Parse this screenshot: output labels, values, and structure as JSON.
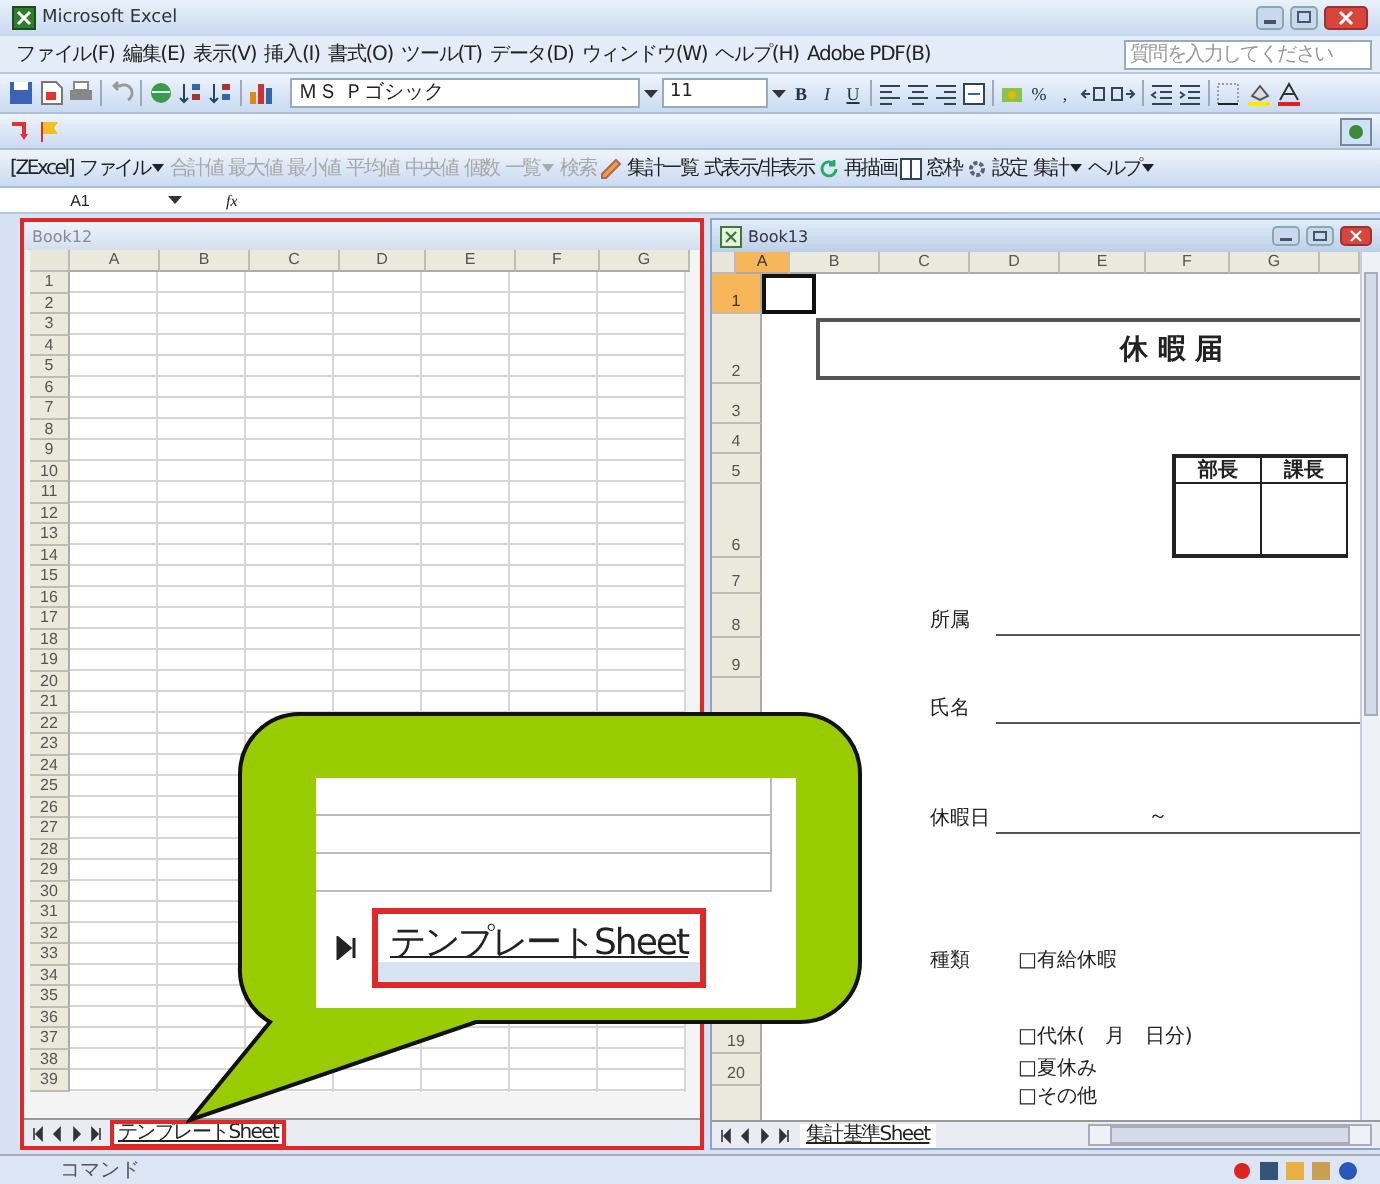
{
  "window": {
    "title": "Microsoft Excel"
  },
  "menu": [
    "ファイル(F)",
    "編集(E)",
    "表示(V)",
    "挿入(I)",
    "書式(O)",
    "ツール(T)",
    "データ(D)",
    "ウィンドウ(W)",
    "ヘルプ(H)",
    "Adobe PDF(B)"
  ],
  "help_search": {
    "placeholder": "質問を入力してください"
  },
  "formatting": {
    "font": "ＭＳ Ｐゴシック",
    "size": "11",
    "style_buttons": [
      "B",
      "I",
      "U"
    ],
    "number_buttons": [
      "%",
      ","
    ]
  },
  "zexcel_toolbar": [
    {
      "label": "[ZExcel]",
      "disabled": false,
      "dropdown": false
    },
    {
      "label": "ファイル",
      "disabled": false,
      "dropdown": true
    },
    {
      "label": "合計値",
      "disabled": true,
      "dropdown": false
    },
    {
      "label": "最大値",
      "disabled": true,
      "dropdown": false
    },
    {
      "label": "最小値",
      "disabled": true,
      "dropdown": false
    },
    {
      "label": "平均値",
      "disabled": true,
      "dropdown": false
    },
    {
      "label": "中央値",
      "disabled": true,
      "dropdown": false
    },
    {
      "label": "個数",
      "disabled": true,
      "dropdown": false
    },
    {
      "label": "一覧",
      "disabled": true,
      "dropdown": true
    },
    {
      "label": "検索",
      "disabled": true,
      "dropdown": false
    },
    {
      "label": "集計一覧",
      "disabled": false,
      "dropdown": false
    },
    {
      "label": "式表示/非表示",
      "disabled": false,
      "dropdown": false
    },
    {
      "label": "再描画",
      "disabled": false,
      "dropdown": false
    },
    {
      "label": "窓枠",
      "disabled": false,
      "dropdown": false
    },
    {
      "label": "設定",
      "disabled": false,
      "dropdown": false
    },
    {
      "label": "集計",
      "disabled": false,
      "dropdown": true
    },
    {
      "label": "ヘルプ",
      "disabled": false,
      "dropdown": true
    }
  ],
  "formula_bar": {
    "name_box": "A1",
    "function_label": "fx"
  },
  "book12": {
    "title": "Book12",
    "columns": [
      "A",
      "B",
      "C",
      "D",
      "E",
      "F",
      "G"
    ],
    "rows": [
      "1",
      "2",
      "3",
      "4",
      "5",
      "6",
      "7",
      "8",
      "9",
      "10",
      "11",
      "12",
      "13",
      "14",
      "15",
      "16",
      "17",
      "18",
      "19",
      "20",
      "21",
      "22",
      "23",
      "24",
      "25",
      "26",
      "27",
      "28",
      "29",
      "30",
      "31",
      "32",
      "33",
      "34",
      "35",
      "36",
      "37",
      "38",
      "39"
    ],
    "sheet_tabs": [
      {
        "label": "テンプレートSheet",
        "selected": true
      }
    ]
  },
  "book13": {
    "title": "Book13",
    "columns": [
      {
        "label": "A",
        "selected": true
      },
      {
        "label": "B",
        "selected": false
      },
      {
        "label": "C",
        "selected": false
      },
      {
        "label": "D",
        "selected": false
      },
      {
        "label": "E",
        "selected": false
      },
      {
        "label": "F",
        "selected": false
      },
      {
        "label": "G",
        "selected": false
      }
    ],
    "rows": [
      {
        "num": "1",
        "selected": true
      },
      {
        "num": "2",
        "selected": false,
        "kind": "title",
        "text": "休 暇 届"
      },
      {
        "num": "3",
        "selected": false
      },
      {
        "num": "4",
        "selected": false
      },
      {
        "num": "5",
        "selected": false,
        "kind": "approval_head",
        "cells": [
          "部長",
          "課長"
        ]
      },
      {
        "num": "6",
        "selected": false,
        "kind": "approval_body"
      },
      {
        "num": "7",
        "selected": false
      },
      {
        "num": "8",
        "selected": false,
        "kind": "field",
        "label": "所属"
      },
      {
        "num": "9",
        "selected": false
      },
      {
        "kind": "field",
        "label": "氏名"
      },
      {},
      {},
      {
        "kind": "field",
        "label": "休暇日",
        "value": "～"
      },
      {},
      {},
      {},
      {
        "kind": "option",
        "label": "種類",
        "option": "□有給休暇"
      },
      {},
      {
        "num": "19",
        "selected": false,
        "kind": "option",
        "option": "□代休(　月　日分)"
      },
      {
        "num": "20",
        "selected": false,
        "kind": "option",
        "option": "□夏休み"
      },
      {
        "kind": "option",
        "option": "□その他"
      }
    ],
    "sheet_tabs": [
      {
        "label": "集計基準Sheet",
        "selected": true
      }
    ]
  },
  "callout": {
    "tab_label": "テンプレートSheet"
  },
  "status_bar": {
    "text": "コマンド"
  }
}
